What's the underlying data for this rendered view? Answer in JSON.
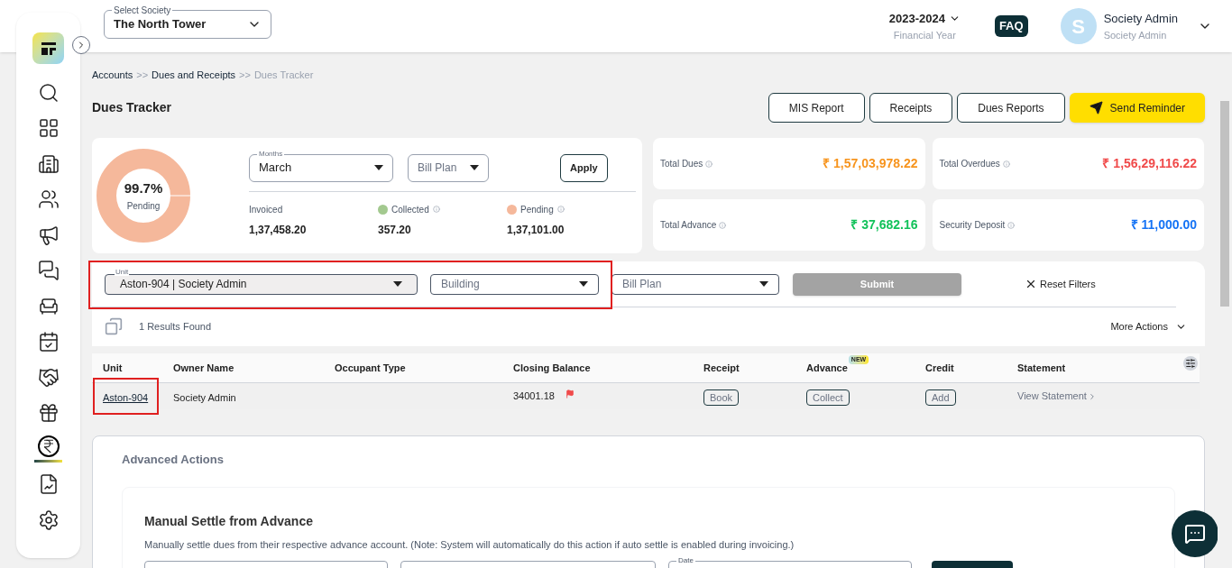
{
  "sidebar": {
    "items": [
      {
        "selected": false
      },
      {
        "selected": false
      },
      {
        "selected": false
      },
      {
        "selected": false
      },
      {
        "selected": false
      },
      {
        "selected": false
      },
      {
        "selected": false
      },
      {
        "selected": false
      },
      {
        "selected": false
      },
      {
        "selected": false
      },
      {
        "selected": true
      },
      {
        "selected": false
      },
      {
        "selected": false
      }
    ]
  },
  "header": {
    "society": {
      "label": "Select Society",
      "value": "The North Tower"
    },
    "year": {
      "value": "2023-2024",
      "caption": "Financial Year"
    },
    "faq": "FAQ",
    "user": {
      "initial": "S",
      "name": "Society Admin",
      "role": "Society Admin"
    }
  },
  "breadcrumb": [
    {
      "label": "Accounts",
      "current": false
    },
    {
      "label": "Dues and Receipts",
      "current": false
    },
    {
      "label": "Dues Tracker",
      "current": true
    }
  ],
  "breadcrumb_separator": ">>",
  "title": "Dues Tracker",
  "actions": [
    {
      "label": "MIS Report",
      "primary": false
    },
    {
      "label": "Receipts",
      "primary": false
    },
    {
      "label": "Dues Reports",
      "primary": false
    },
    {
      "label": "Send Reminder",
      "primary": true
    }
  ],
  "summary": {
    "percent": "99.7%",
    "caption": "Pending",
    "months": {
      "label": "Months",
      "value": "March"
    },
    "bill_plan": {
      "placeholder": "Bill Plan"
    },
    "apply": "Apply",
    "stats": [
      {
        "label": "Invoiced",
        "value": "1,37,458.20"
      },
      {
        "label": "Collected",
        "value": "357.20",
        "color": "#a3c98f"
      },
      {
        "label": "Pending",
        "value": "1,37,101.00",
        "color": "#f5b89b"
      }
    ]
  },
  "totals": [
    {
      "label": "Total Dues",
      "value": "₹ 1,57,03,978.22",
      "color": "#f7941d"
    },
    {
      "label": "Total Overdues",
      "value": "₹ 1,56,29,116.22",
      "color": "#f04a4a"
    },
    {
      "label": "Total Advance",
      "value": "₹ 37,682.16",
      "color": "#12c25a"
    },
    {
      "label": "Security Deposit",
      "value": "₹ 11,000.00",
      "color": "#1473f5"
    }
  ],
  "filters": {
    "highlighted": true,
    "unit": {
      "label": "Unit",
      "value": "Aston-904 | Society Admin"
    },
    "building": {
      "placeholder": "Building"
    },
    "bill_plan": {
      "placeholder": "Bill Plan"
    },
    "submit": {
      "label": "Submit",
      "disabled": true
    },
    "reset": "Reset Filters"
  },
  "results": "1 Results Found",
  "more_actions": "More Actions",
  "table": {
    "columns": [
      {
        "label": "Unit"
      },
      {
        "label": "Owner Name"
      },
      {
        "label": "Occupant Type"
      },
      {
        "label": "Closing Balance"
      },
      {
        "label": "Receipt"
      },
      {
        "label": "Advance",
        "badge": "NEW"
      },
      {
        "label": "Credit"
      },
      {
        "label": "Statement"
      }
    ],
    "rows": [
      {
        "unit": "Aston-904",
        "unit_highlighted": true,
        "owner": "Society Admin",
        "balance": "34001.18",
        "flagged": true,
        "receipt": "Book",
        "advance": "Collect",
        "credit": "Add",
        "statement": "View Statement"
      }
    ]
  },
  "advanced": {
    "title": "Advanced Actions",
    "section_title": "Manual Settle from Advance",
    "description": "Manually settle dues from their respective advance account. (Note: System will automatically do this action if auto settle is enabled during invoicing.)",
    "date_label": "Date"
  }
}
